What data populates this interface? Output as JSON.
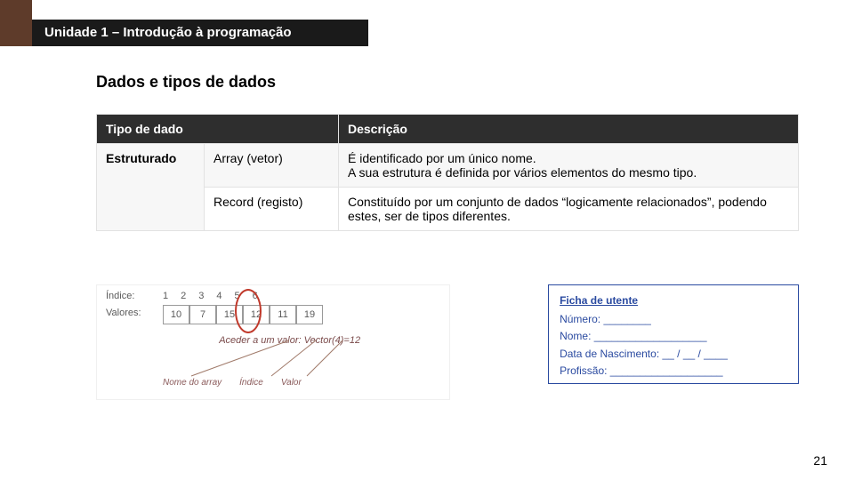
{
  "header": {
    "unit_title": "Unidade 1 – Introdução à programação",
    "section_title": "Dados e tipos de dados"
  },
  "table": {
    "col_type": "Tipo de dado",
    "col_desc": "Descrição",
    "row1_type": "Estruturado",
    "row1_sub": "Array (vetor)",
    "row1_desc": "É identificado por um único nome.\nA sua estrutura é definida por vários elementos do mesmo tipo.",
    "row2_sub": "Record (registo)",
    "row2_desc": "Constituído por um conjunto de dados “logicamente relacionados”, podendo estes, ser de tipos diferentes."
  },
  "array_fig": {
    "indice_label": "Índice:",
    "valores_label": "Valores:",
    "indices": [
      "1",
      "2",
      "3",
      "4",
      "5",
      "6"
    ],
    "values": [
      "10",
      "7",
      "15",
      "12",
      "11",
      "19"
    ],
    "access_caption": "Aceder a um valor: Vector(4)=12",
    "legend_name": "Nome do array",
    "legend_index": "Índice",
    "legend_value": "Valor"
  },
  "record_fig": {
    "title": "Ficha de utente",
    "numero": "Número: ________",
    "nome": "Nome: ___________________",
    "data": "Data de Nascimento: __ / __ / ____",
    "prof": "Profissão: ___________________"
  },
  "page_number": "21"
}
